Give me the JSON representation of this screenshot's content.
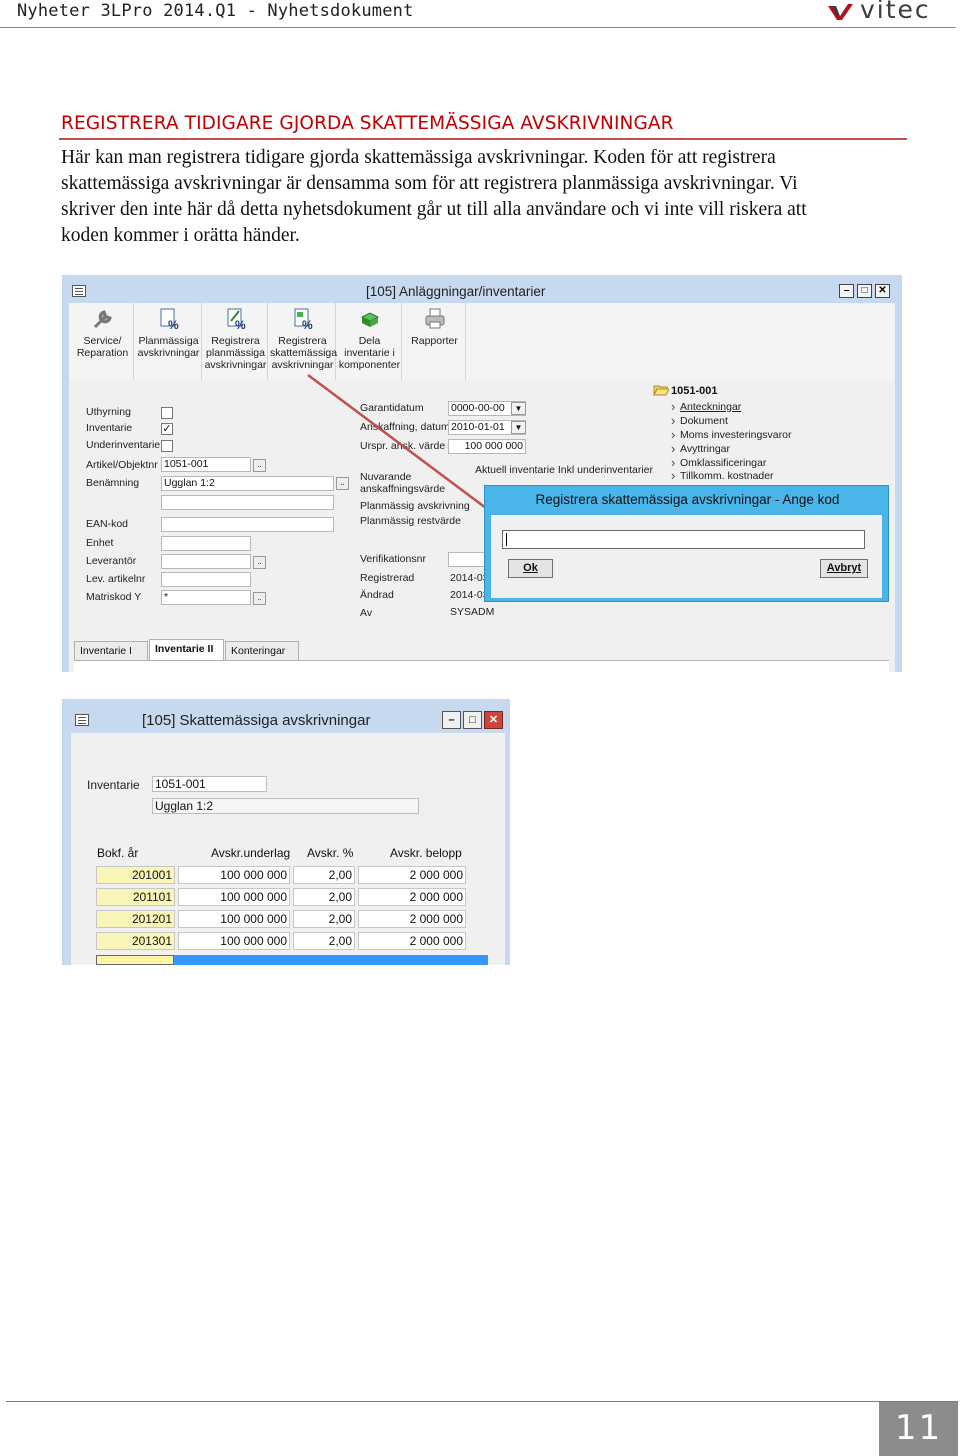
{
  "header": {
    "title": "Nyheter 3LPro 2014.Q1 - Nyhetsdokument",
    "logo_text": "vitec"
  },
  "section": {
    "heading": "REGISTRERA TIDIGARE GJORDA SKATTEMÄSSIGA AVSKRIVNINGAR",
    "body_lines": [
      "Här kan man registrera tidigare gjorda skattemässiga avskrivningar. Koden för att registrera",
      "skattemässiga avskrivningar är densamma som för att registrera planmässiga avskrivningar. Vi",
      "skriver den inte här då detta nyhetsdokument går ut till alla användare och vi inte vill riskera att",
      "koden kommer i orätta händer."
    ]
  },
  "screenshot1": {
    "window_title": "[105]  Anläggningar/inventarier",
    "ribbon": [
      {
        "line1": "Service/",
        "line2": "Reparation",
        "line3": "",
        "icon": "wrench-icon"
      },
      {
        "line1": "Planmässiga",
        "line2": "avskrivningar",
        "line3": "",
        "icon": "percent-doc-icon"
      },
      {
        "line1": "Registrera",
        "line2": "planmässiga",
        "line3": "avskrivningar",
        "icon": "edit-percent-icon"
      },
      {
        "line1": "Registrera",
        "line2": "skattemässiga",
        "line3": "avskrivningar",
        "icon": "tax-percent-icon"
      },
      {
        "line1": "Dela",
        "line2": "inventarie i",
        "line3": "komponenter",
        "icon": "split-icon"
      },
      {
        "line1": "Rapporter",
        "line2": "",
        "line3": "",
        "icon": "printer-icon"
      }
    ],
    "left_form": {
      "uthyrning": "Uthyrning",
      "inventarie": "Inventarie",
      "underinventarie": "Underinventarie",
      "artikel_label": "Artikel/Objektnr",
      "artikel_value": "1051-001",
      "benamning_label": "Benämning",
      "benamning_value": "Ugglan 1:2",
      "ean_label": "EAN-kod",
      "enhet_label": "Enhet",
      "leverantor_label": "Leverantör",
      "lev_artikel_label": "Lev. artikelnr",
      "matriskod_label": "Matriskod Y",
      "matriskod_value": "*"
    },
    "middle_form": {
      "garanti_label": "Garantidatum",
      "garanti_value": "0000-00-00",
      "anskaffning_label": "Anskaffning, datum",
      "anskaffning_value": "2010-01-01",
      "urspr_label": "Urspr. ansk. värde",
      "urspr_value": "100 000 000",
      "aktuell_label": "Aktuell inventarie Inkl underinventarier",
      "nuvarande_line1": "Nuvarande",
      "nuvarande_line2": "anskaffningsvärde",
      "plan_avskr_label": "Planmässig avskrivning",
      "plan_rest_label": "Planmässig restvärde",
      "verifikation_label": "Verifikationsnr",
      "registrerad_label": "Registrerad",
      "registrerad_value": "2014-03",
      "andrad_label": "Ändrad",
      "andrad_value": "2014-03",
      "av_label": "Av",
      "av_value": "SYSADM"
    },
    "tree": {
      "root": "1051-001",
      "items": [
        "Anteckningar",
        "Dokument",
        "Moms investeringsvaror",
        "Avyttringar",
        "Omklassificeringar",
        "Tillkomm. kostnader"
      ]
    },
    "dialog": {
      "title": "Registrera skattemässiga avskrivningar - Ange kod",
      "ok_label": "Ok",
      "cancel_label": "Avbryt"
    },
    "tabs": [
      "Inventarie I",
      "Inventarie II",
      "Konteringar"
    ],
    "active_tab": "Inventarie II"
  },
  "screenshot2": {
    "window_title": "[105]  Skattemässiga avskrivningar",
    "inventarie_label": "Inventarie",
    "inventarie_value": "1051-001",
    "name_value": "Ugglan 1:2",
    "columns": [
      "Bokf. år",
      "Avskr.underlag",
      "Avskr. %",
      "Avskr. belopp"
    ],
    "rows": [
      [
        "201001",
        "100 000 000",
        "2,00",
        "2 000 000"
      ],
      [
        "201101",
        "100 000 000",
        "2,00",
        "2 000 000"
      ],
      [
        "201201",
        "100 000 000",
        "2,00",
        "2 000 000"
      ],
      [
        "201301",
        "100 000 000",
        "2,00",
        "2 000 000"
      ]
    ]
  },
  "footer": {
    "page_number": "11"
  },
  "colors": {
    "heading_red": "#c00000",
    "dialog_blue": "#4ab5e8",
    "window_blue": "#c6d9ee",
    "selection_blue": "#3399ff",
    "year_yellow": "#faf6b8"
  }
}
